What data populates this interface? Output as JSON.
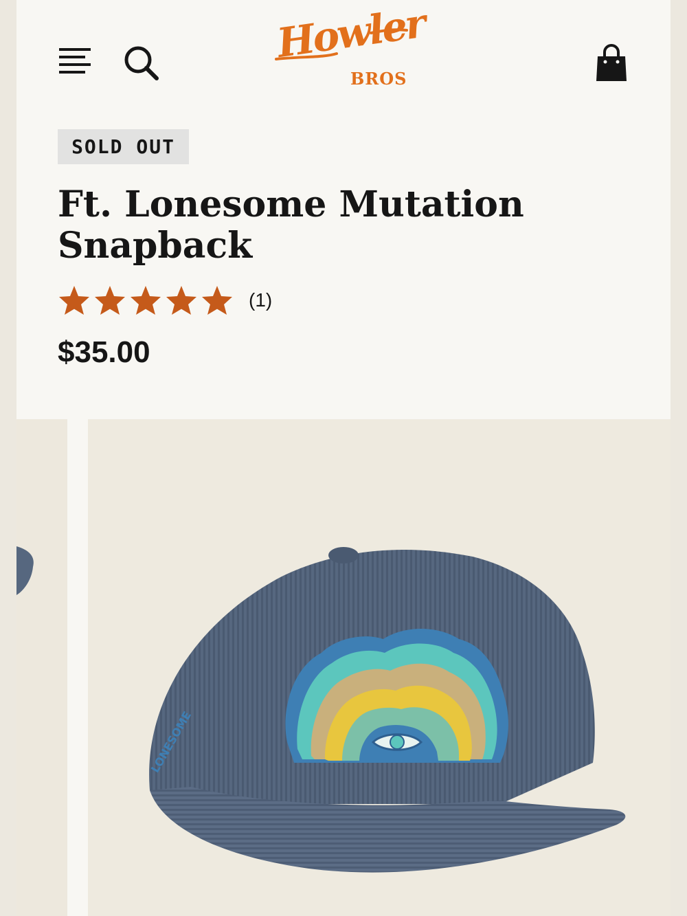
{
  "header": {
    "menu_icon": "hamburger-menu-icon",
    "search_icon": "search-icon",
    "cart_icon": "shopping-bag-icon",
    "logo_script": "Howler",
    "logo_sub": "BROS",
    "brand_color": "#e2701c"
  },
  "product": {
    "badge": "SOLD OUT",
    "title": "Ft. Lonesome Mutation Snapback",
    "rating": 5,
    "rating_max": 5,
    "review_count": "(1)",
    "price": "$35.00",
    "star_color": "#c55a1a"
  },
  "gallery": {
    "hat_embroidery_text": "LONESOME",
    "hat_color": "#56677f"
  }
}
